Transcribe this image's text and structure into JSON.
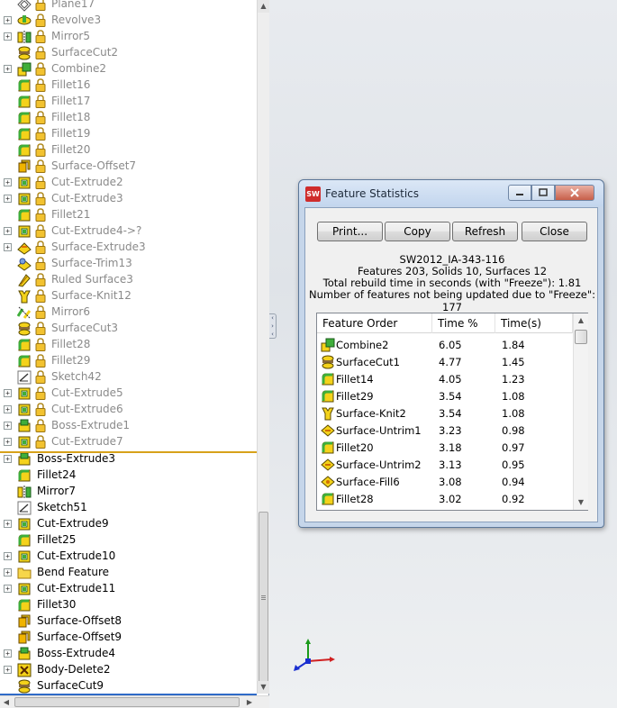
{
  "tree": {
    "frozen_items": [
      {
        "label": "Plane17",
        "icon": "plane-icon",
        "expander": false
      },
      {
        "label": "Revolve3",
        "icon": "revolve-icon",
        "expander": true
      },
      {
        "label": "Mirror5",
        "icon": "mirror-icon",
        "expander": true
      },
      {
        "label": "SurfaceCut2",
        "icon": "surface-cut-icon",
        "expander": false
      },
      {
        "label": "Combine2",
        "icon": "combine-icon",
        "expander": true
      },
      {
        "label": "Fillet16",
        "icon": "fillet-icon",
        "expander": false
      },
      {
        "label": "Fillet17",
        "icon": "fillet-icon",
        "expander": false
      },
      {
        "label": "Fillet18",
        "icon": "fillet-icon",
        "expander": false
      },
      {
        "label": "Fillet19",
        "icon": "fillet-icon",
        "expander": false
      },
      {
        "label": "Fillet20",
        "icon": "fillet-icon",
        "expander": false
      },
      {
        "label": "Surface-Offset7",
        "icon": "surface-offset-icon",
        "expander": false
      },
      {
        "label": "Cut-Extrude2",
        "icon": "cut-extrude-icon",
        "expander": true
      },
      {
        "label": "Cut-Extrude3",
        "icon": "cut-extrude-icon",
        "expander": true
      },
      {
        "label": "Fillet21",
        "icon": "fillet-icon",
        "expander": false
      },
      {
        "label": "Cut-Extrude4->?",
        "icon": "cut-extrude-icon",
        "expander": true
      },
      {
        "label": "Surface-Extrude3",
        "icon": "surface-extrude-icon",
        "expander": true
      },
      {
        "label": "Surface-Trim13",
        "icon": "surface-trim-icon",
        "expander": false
      },
      {
        "label": "Ruled Surface3",
        "icon": "ruled-surface-icon",
        "expander": false
      },
      {
        "label": "Surface-Knit12",
        "icon": "surface-knit-icon",
        "expander": false
      },
      {
        "label": "Mirror6",
        "icon": "mirror-surface-icon",
        "expander": false
      },
      {
        "label": "SurfaceCut3",
        "icon": "surface-cut-icon",
        "expander": false
      },
      {
        "label": "Fillet28",
        "icon": "fillet-icon",
        "expander": false
      },
      {
        "label": "Fillet29",
        "icon": "fillet-icon",
        "expander": false
      },
      {
        "label": "Sketch42",
        "icon": "sketch-icon",
        "expander": false
      },
      {
        "label": "Cut-Extrude5",
        "icon": "cut-extrude-icon",
        "expander": true
      },
      {
        "label": "Cut-Extrude6",
        "icon": "cut-extrude-icon",
        "expander": true
      },
      {
        "label": "Boss-Extrude1",
        "icon": "boss-extrude-icon",
        "expander": true
      },
      {
        "label": "Cut-Extrude7",
        "icon": "cut-extrude-icon",
        "expander": true
      }
    ],
    "active_items": [
      {
        "label": "Boss-Extrude3",
        "icon": "boss-extrude-icon",
        "expander": true
      },
      {
        "label": "Fillet24",
        "icon": "fillet-icon",
        "expander": false
      },
      {
        "label": "Mirror7",
        "icon": "mirror-icon",
        "expander": false
      },
      {
        "label": "Sketch51",
        "icon": "sketch-icon",
        "expander": false
      },
      {
        "label": "Cut-Extrude9",
        "icon": "cut-extrude-icon",
        "expander": true
      },
      {
        "label": "Fillet25",
        "icon": "fillet-icon",
        "expander": false
      },
      {
        "label": "Cut-Extrude10",
        "icon": "cut-extrude-icon",
        "expander": true
      },
      {
        "label": "Bend Feature",
        "icon": "folder-icon",
        "expander": true
      },
      {
        "label": "Cut-Extrude11",
        "icon": "cut-extrude-icon",
        "expander": true
      },
      {
        "label": "Fillet30",
        "icon": "fillet-icon",
        "expander": false
      },
      {
        "label": "Surface-Offset8",
        "icon": "surface-offset-icon",
        "expander": false
      },
      {
        "label": "Surface-Offset9",
        "icon": "surface-offset-icon",
        "expander": false
      },
      {
        "label": "Boss-Extrude4",
        "icon": "boss-extrude-icon",
        "expander": true
      },
      {
        "label": "Body-Delete2",
        "icon": "body-delete-icon",
        "expander": true
      },
      {
        "label": "SurfaceCut9",
        "icon": "surface-cut-icon",
        "expander": false
      }
    ]
  },
  "dialog": {
    "title": "Feature Statistics",
    "app_icon_text": "SW",
    "buttons": {
      "print": "Print...",
      "copy": "Copy",
      "refresh": "Refresh",
      "close": "Close"
    },
    "info": {
      "name": "SW2012_IA-343-116",
      "counts": "Features 203, Solids 10, Surfaces 12",
      "rebuild": "Total rebuild time in seconds (with \"Freeze\"): 1.81",
      "frozen": "Number of features not being updated due to \"Freeze\": 177"
    },
    "columns": [
      "Feature Order",
      "Time %",
      "Time(s)"
    ],
    "rows": [
      {
        "name": "Combine2",
        "pct": "6.05",
        "sec": "1.84",
        "icon": "combine-icon"
      },
      {
        "name": "SurfaceCut1",
        "pct": "4.77",
        "sec": "1.45",
        "icon": "surface-cut-icon"
      },
      {
        "name": "Fillet14",
        "pct": "4.05",
        "sec": "1.23",
        "icon": "fillet-icon"
      },
      {
        "name": "Fillet29",
        "pct": "3.54",
        "sec": "1.08",
        "icon": "fillet-icon"
      },
      {
        "name": "Surface-Knit2",
        "pct": "3.54",
        "sec": "1.08",
        "icon": "surface-knit-icon"
      },
      {
        "name": "Surface-Untrim1",
        "pct": "3.23",
        "sec": "0.98",
        "icon": "surface-untrim-icon"
      },
      {
        "name": "Fillet20",
        "pct": "3.18",
        "sec": "0.97",
        "icon": "fillet-icon"
      },
      {
        "name": "Surface-Untrim2",
        "pct": "3.13",
        "sec": "0.95",
        "icon": "surface-untrim-icon"
      },
      {
        "name": "Surface-Fill6",
        "pct": "3.08",
        "sec": "0.94",
        "icon": "surface-fill-icon"
      },
      {
        "name": "Fillet28",
        "pct": "3.02",
        "sec": "0.92",
        "icon": "fillet-icon"
      }
    ]
  },
  "colors": {
    "freeze_bar": "#d7a21a",
    "tree_frozen_text": "#8a8a8a",
    "icon_yellow": "#f4d21a",
    "icon_green": "#3fae3a"
  }
}
